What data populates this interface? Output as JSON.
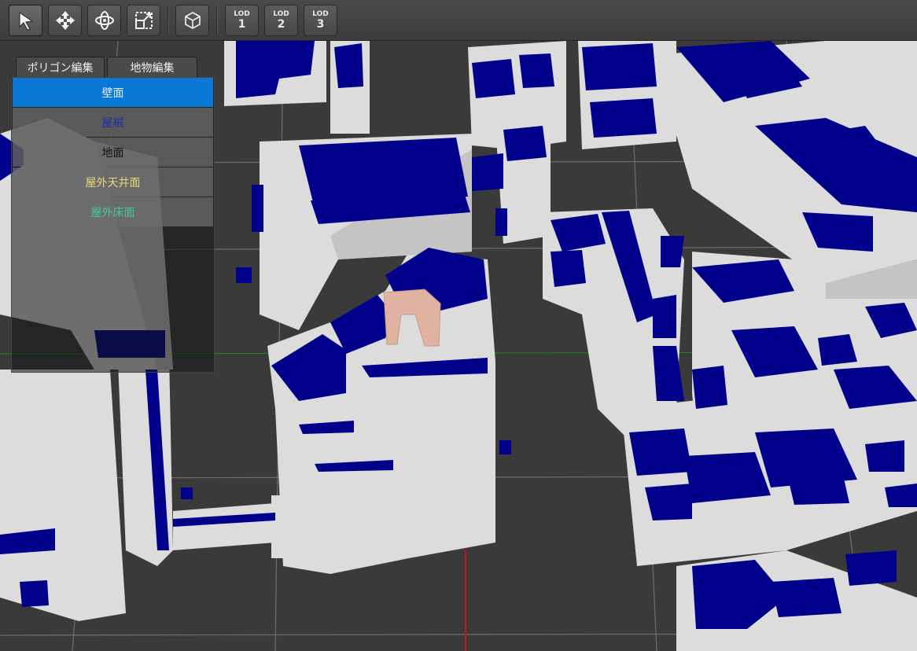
{
  "toolbar": {
    "tools": [
      {
        "name": "select-tool-button",
        "icon": "cursor-arrow-icon",
        "active": true
      },
      {
        "name": "move-tool-button",
        "icon": "move-arrows-icon",
        "active": false
      },
      {
        "name": "rotate-tool-button",
        "icon": "rotate-orbit-icon",
        "active": false
      },
      {
        "name": "scale-tool-button",
        "icon": "scale-box-icon",
        "active": false
      },
      {
        "name": "view-cube-button",
        "icon": "cube-icon",
        "active": false
      }
    ],
    "lod": [
      {
        "label": "LOD",
        "level": "1"
      },
      {
        "label": "LOD",
        "level": "2"
      },
      {
        "label": "LOD",
        "level": "3"
      }
    ]
  },
  "panel": {
    "tabs": [
      {
        "label": "ポリゴン編集"
      },
      {
        "label": "地物編集"
      }
    ],
    "items": [
      {
        "label": "壁面",
        "color": "#e6f0ff",
        "selected": true
      },
      {
        "label": "屋根",
        "color": "#1f2fa8",
        "selected": false
      },
      {
        "label": "地面",
        "color": "#111111",
        "selected": false
      },
      {
        "label": "屋外天井面",
        "color": "#e8d67a",
        "selected": false
      },
      {
        "label": "屋外床面",
        "color": "#47c5a4",
        "selected": false
      }
    ]
  },
  "scene": {
    "building_wall_color": "#dcdcdc",
    "roof_color": "#00008b",
    "highlight_color": "#e0b2a2",
    "ground_color": "#3a3a3a",
    "grid_color": "#6e6e6e"
  }
}
